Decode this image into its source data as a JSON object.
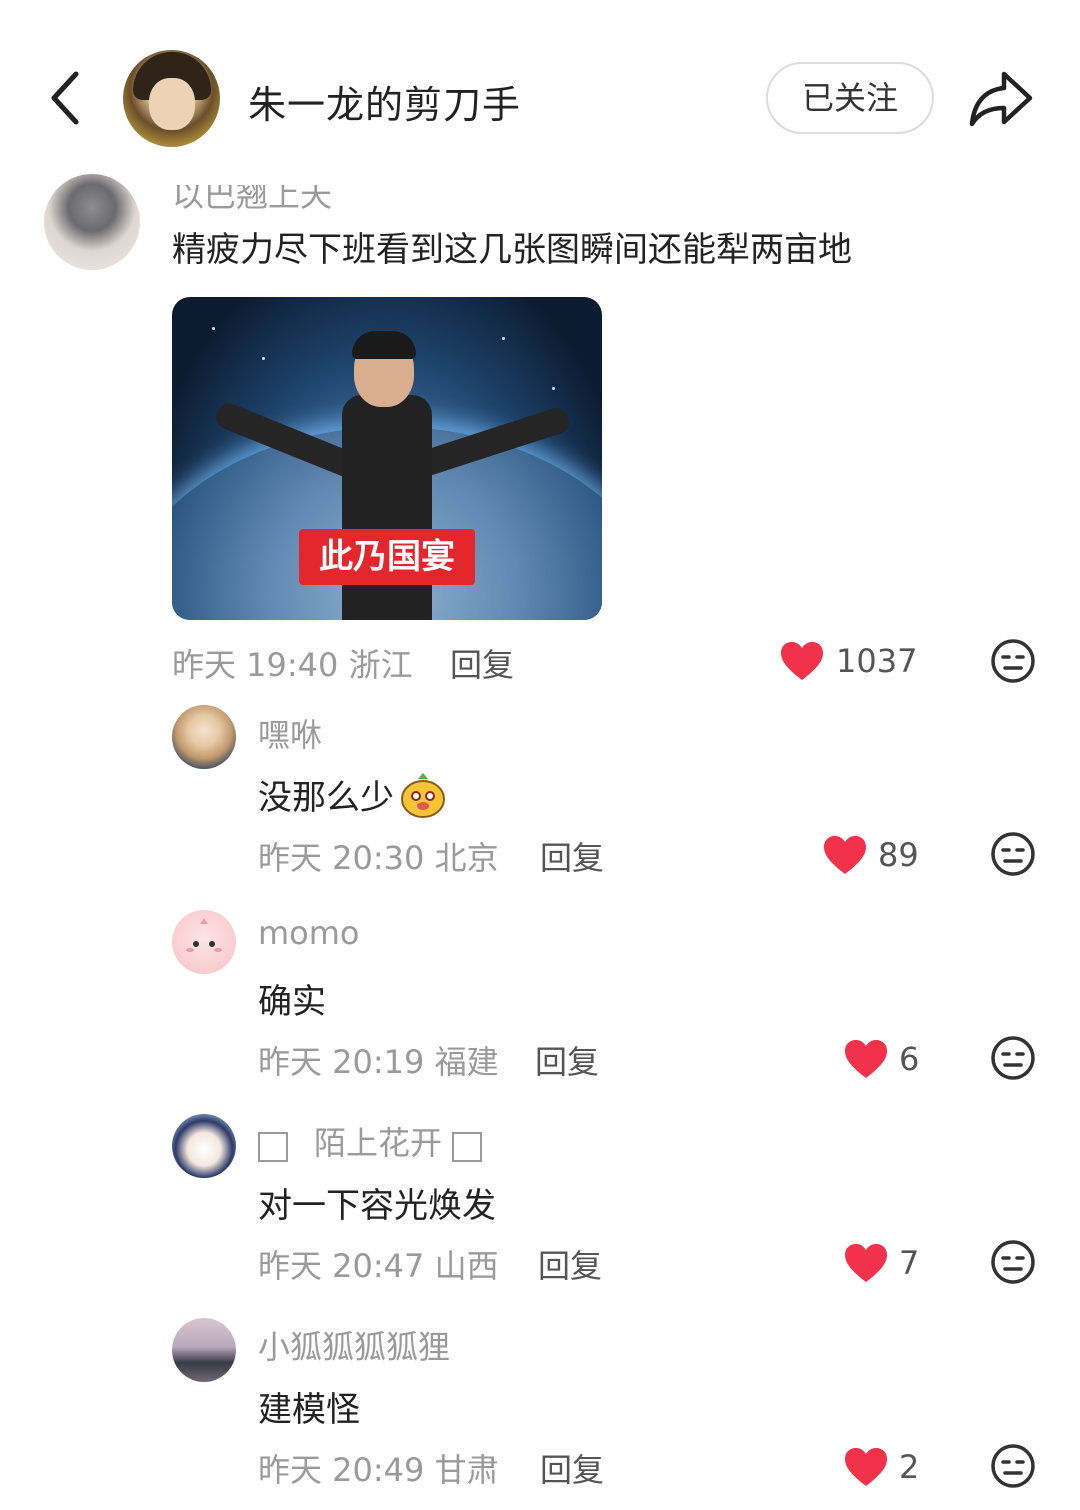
{
  "header": {
    "author_name": "朱一龙的剪刀手",
    "follow_label": "已关注"
  },
  "colors": {
    "like_red": "#f2314a",
    "meta_gray": "#9a9a9a",
    "caption_red": "#e4272d"
  },
  "comments": [
    {
      "username": "以巴翘上天",
      "text": "精疲力尽下班看到这几张图瞬间还能犁两亩地",
      "image_caption": "此乃国宴",
      "time": "昨天 19:40",
      "location": "浙江",
      "reply_label": "回复",
      "likes": "1037"
    }
  ],
  "replies": [
    {
      "username": "嘿咻",
      "text": "没那么少",
      "emoji": "mango-face-emoji",
      "time": "昨天 20:30",
      "location": "北京",
      "reply_label": "回复",
      "likes": "89"
    },
    {
      "username": "momo",
      "text": "确实",
      "time": "昨天 20:19",
      "location": "福建",
      "reply_label": "回复",
      "likes": "6"
    },
    {
      "username": "陌上花开",
      "text": "对一下容光焕发",
      "time": "昨天 20:47",
      "location": "山西",
      "reply_label": "回复",
      "likes": "7"
    },
    {
      "username": "小狐狐狐狐狸",
      "text": "建模怪",
      "time": "昨天 20:49",
      "location": "甘肃",
      "reply_label": "回复",
      "likes": "2"
    }
  ]
}
